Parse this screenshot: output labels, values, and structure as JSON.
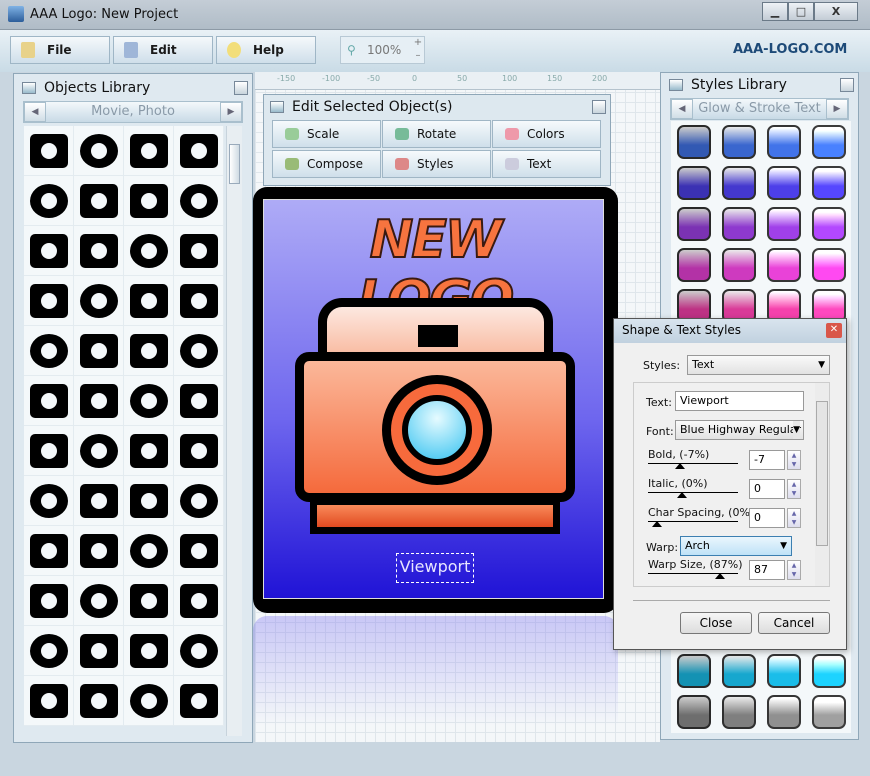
{
  "window": {
    "title": "AAA Logo: New Project"
  },
  "toolbar": {
    "file": "File",
    "edit": "Edit",
    "help": "Help",
    "zoom": "100%",
    "zoom_plus": "+",
    "zoom_minus": "–",
    "brand": "AAA-LOGO.COM"
  },
  "objects_library": {
    "title": "Objects Library",
    "category": "Movie, Photo",
    "icon_count": 48
  },
  "ruler": {
    "ticks": [
      "-150",
      "-100",
      "-50",
      "0",
      "50",
      "100",
      "150",
      "200"
    ]
  },
  "edit_panel": {
    "title": "Edit Selected Object(s)",
    "buttons": [
      "Scale",
      "Rotate",
      "Colors",
      "Compose",
      "Styles",
      "Text"
    ]
  },
  "logo": {
    "headline": "NEW LOGO",
    "caption": "Viewport",
    "colors": {
      "bg_top": "#a9a6f5",
      "bg_bottom": "#2418d8",
      "camera_body": "#f86a3c",
      "lens": "#5fd3f5"
    }
  },
  "styles_library": {
    "title": "Styles Library",
    "category": "Glow & Stroke Text",
    "swatch_rows": [
      "#3f6fe0",
      "#4a3de0",
      "#9a3ee0",
      "#e03fd0",
      "#ec3fa5",
      "#19b6e0",
      "#8a8a8a"
    ]
  },
  "dialog": {
    "title": "Shape & Text Styles",
    "styles_label": "Styles:",
    "styles_value": "Text",
    "text_label": "Text:",
    "text_value": "Viewport",
    "font_label": "Font:",
    "font_value": "Blue Highway Regular",
    "bold_label": "Bold, (-7%)",
    "bold_value": "-7",
    "italic_label": "Italic, (0%)",
    "italic_value": "0",
    "spacing_label": "Char Spacing, (0%",
    "spacing_value": "0",
    "warp_label": "Warp:",
    "warp_value": "Arch",
    "warpsize_label": "Warp Size, (87%)",
    "warpsize_value": "87",
    "close": "Close",
    "cancel": "Cancel"
  }
}
